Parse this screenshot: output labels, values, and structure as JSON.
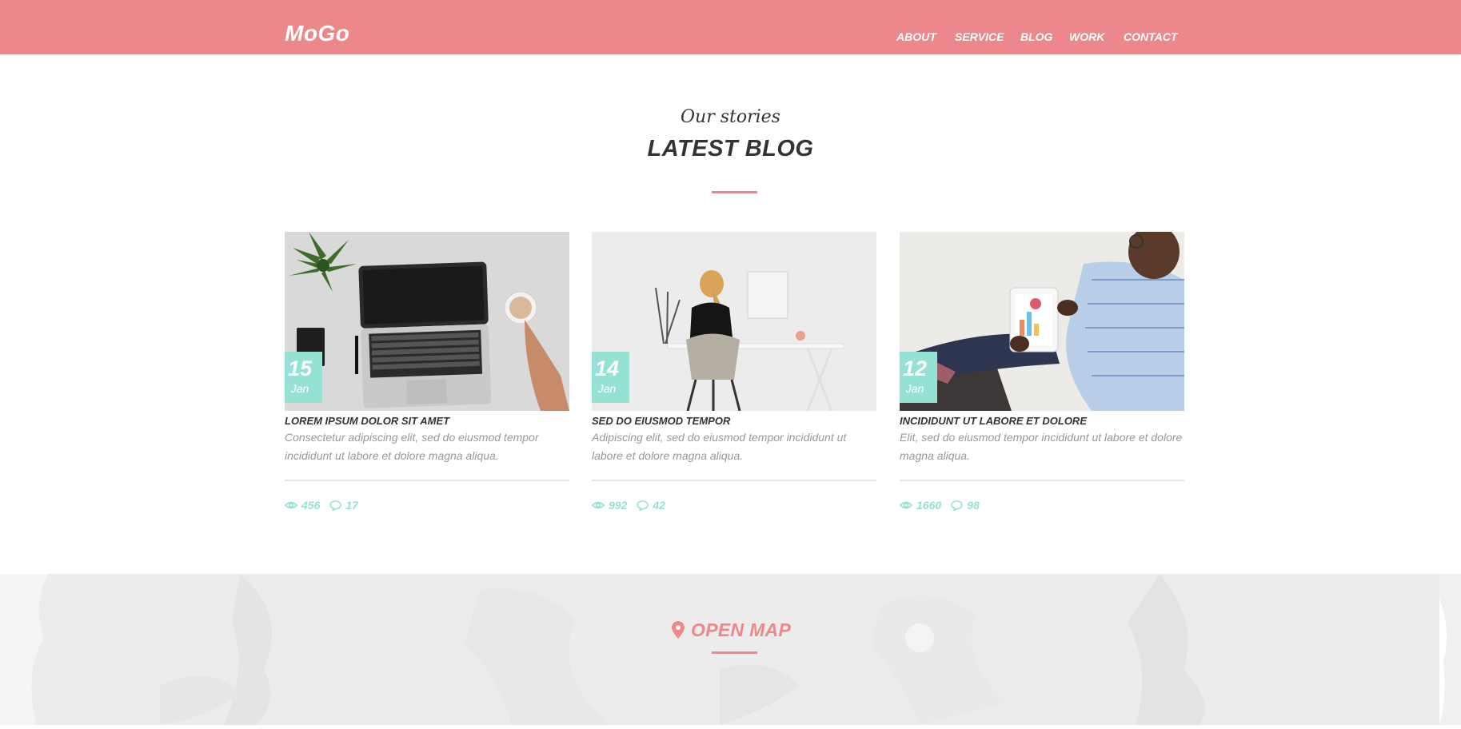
{
  "header": {
    "logo": "MoGo",
    "nav": [
      "ABOUT",
      "SERVICE",
      "BLOG",
      "WORK",
      "CONTACT"
    ]
  },
  "section": {
    "kicker": "Our stories",
    "title": "LATEST BLOG"
  },
  "posts": [
    {
      "day": "15",
      "month": "Jan",
      "title": "LOREM IPSUM DOLOR SIT AMET",
      "text": "Consectetur adipiscing elit, sed do eiusmod tempor incididunt ut labore et dolore magna aliqua.",
      "views": "456",
      "comments": "17"
    },
    {
      "day": "14",
      "month": "Jan",
      "title": "SED DO EIUSMOD TEMPOR",
      "text": "Adipiscing elit, sed do eiusmod tempor incididunt ut labore et dolore magna aliqua.",
      "views": "992",
      "comments": "42"
    },
    {
      "day": "12",
      "month": "Jan",
      "title": "INCIDIDUNT UT LABORE ET DOLORE",
      "text": "Elit, sed do eiusmod tempor incididunt ut labore et dolore magna aliqua.",
      "views": "1660",
      "comments": "98"
    }
  ],
  "map": {
    "label": "OPEN MAP",
    "icon": "map-pin-icon"
  },
  "colors": {
    "accent": "#ec888c",
    "badge": "#95e1d3",
    "text_dark": "#333333",
    "text_muted": "#999999"
  }
}
